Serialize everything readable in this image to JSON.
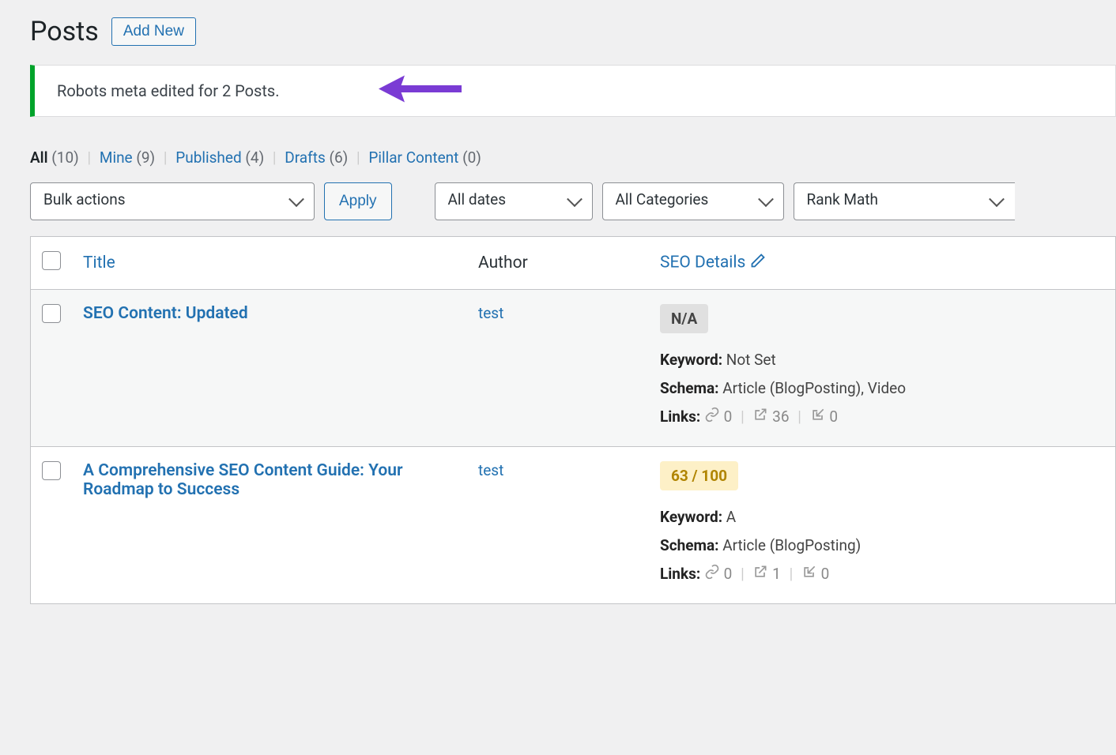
{
  "page_title": "Posts",
  "add_new_label": "Add New",
  "notice_text": "Robots meta edited for 2 Posts.",
  "filters": {
    "all": {
      "label": "All",
      "count": "(10)"
    },
    "mine": {
      "label": "Mine",
      "count": "(9)"
    },
    "published": {
      "label": "Published",
      "count": "(4)"
    },
    "drafts": {
      "label": "Drafts",
      "count": "(6)"
    },
    "pillar": {
      "label": "Pillar Content",
      "count": "(0)"
    }
  },
  "controls": {
    "bulk_actions": "Bulk actions",
    "apply": "Apply",
    "all_dates": "All dates",
    "all_categories": "All Categories",
    "rank_math": "Rank Math"
  },
  "columns": {
    "title": "Title",
    "author": "Author",
    "seo": "SEO Details"
  },
  "seo_labels": {
    "keyword": "Keyword:",
    "schema": "Schema:",
    "links": "Links:"
  },
  "rows": [
    {
      "title": "SEO Content: Updated",
      "author": "test",
      "score": "N/A",
      "score_class": "score-na",
      "keyword": "Not Set",
      "schema": "Article (BlogPosting), Video",
      "links": {
        "internal": "0",
        "external": "36",
        "incoming": "0"
      }
    },
    {
      "title": "A Comprehensive SEO Content Guide: Your Roadmap to Success",
      "author": "test",
      "score": "63 / 100",
      "score_class": "score-ok",
      "keyword": "A",
      "schema": "Article (BlogPosting)",
      "links": {
        "internal": "0",
        "external": "1",
        "incoming": "0"
      }
    }
  ]
}
